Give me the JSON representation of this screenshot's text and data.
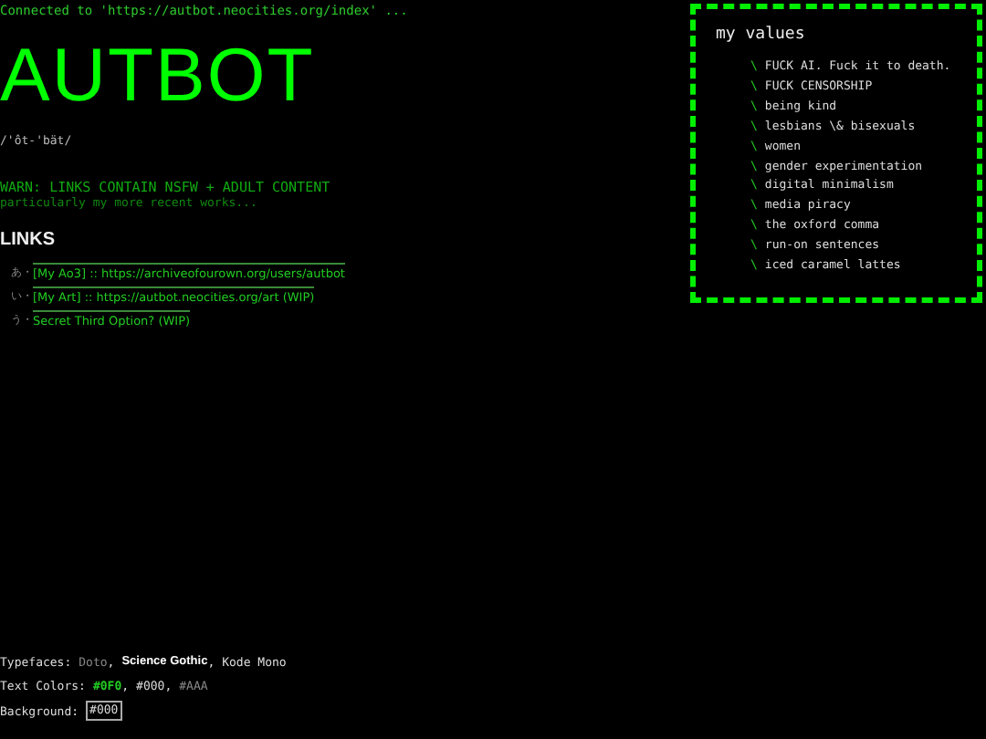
{
  "status_line": "Connected to 'https://autbot.neocities.org/index'  ...",
  "title": "AUTBOT",
  "pronunciation": "/'ôt-'bät/",
  "warning": "WARN: LINKS CONTAIN NSFW + ADULT CONTENT",
  "warning_note": "particularly my more recent works...",
  "links_heading": "LINKS",
  "links": [
    {
      "marker": "あ・",
      "text": "[My Ao3] :: https://archiveofourown.org/users/autbot"
    },
    {
      "marker": "い・",
      "text": "[My Art] :: https://autbot.neocities.org/art (WIP)"
    },
    {
      "marker": "う・",
      "text": "Secret Third Option? (WIP)"
    }
  ],
  "values_panel": {
    "title": "my values",
    "items": [
      {
        "bullet": "\\",
        "text": "FUCK AI. Fuck it to death."
      },
      {
        "bullet": "\\",
        "text": "FUCK CENSORSHIP"
      },
      {
        "bullet": "\\",
        "text": "being kind"
      },
      {
        "bullet": "\\",
        "text": "lesbians \\& bisexuals"
      },
      {
        "bullet": "\\",
        "text": "women"
      },
      {
        "bullet": "\\",
        "text": "gender experimentation"
      },
      {
        "bullet": "\\",
        "text": "digital minimalism"
      },
      {
        "bullet": "\\",
        "text": "media piracy"
      },
      {
        "bullet": "\\",
        "text": "the oxford comma"
      },
      {
        "bullet": "\\",
        "text": "run-on sentences"
      },
      {
        "bullet": "\\",
        "text": "iced caramel lattes"
      }
    ]
  },
  "footer": [
    {
      "label": "Typefaces:",
      "separator": ",",
      "items": [
        {
          "text": "Doto",
          "kind": "faint"
        },
        {
          "text": "Science Gothic",
          "kind": "bold"
        },
        {
          "text": "Kode Mono",
          "kind": "plain"
        }
      ]
    },
    {
      "label": "Text Colors:",
      "separator": ",",
      "items": [
        {
          "text": "#0F0",
          "kind": "green"
        },
        {
          "text": "#000",
          "kind": "plain"
        },
        {
          "text": "#AAA",
          "kind": "faint"
        }
      ]
    },
    {
      "label": "Background:",
      "items": [
        {
          "text": "#000",
          "kind": "boxed"
        }
      ]
    }
  ]
}
